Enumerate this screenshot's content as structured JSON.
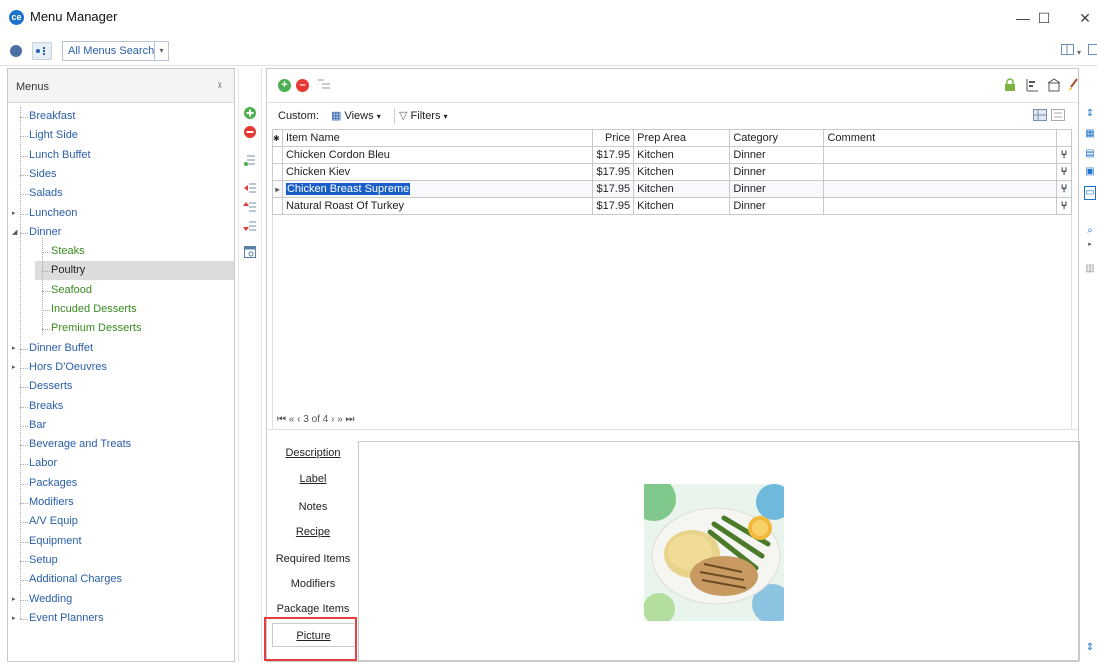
{
  "window": {
    "title": "Menu Manager",
    "minimize": "—",
    "maximize": "☐",
    "close": "✕"
  },
  "toolbar": {
    "search_label": "All Menus Search",
    "search_dropdown": "▾"
  },
  "left_panel": {
    "header": "Menus",
    "items": [
      {
        "label": "Breakfast",
        "level": 0,
        "expandable": false,
        "color": "#2a5ea8"
      },
      {
        "label": "Light Side",
        "level": 0,
        "expandable": false,
        "color": "#2a5ea8"
      },
      {
        "label": "Lunch Buffet",
        "level": 0,
        "expandable": false,
        "color": "#2a5ea8"
      },
      {
        "label": "Sides",
        "level": 0,
        "expandable": false,
        "color": "#2a5ea8"
      },
      {
        "label": "Salads",
        "level": 0,
        "expandable": false,
        "color": "#2a5ea8"
      },
      {
        "label": "Luncheon",
        "level": 0,
        "expandable": true,
        "color": "#2a5ea8"
      },
      {
        "label": "Dinner",
        "level": 0,
        "expanded": true,
        "color": "#2a5ea8"
      },
      {
        "label": "Steaks",
        "level": 1,
        "color": "#3a8a20"
      },
      {
        "label": "Poultry",
        "level": 1,
        "selected": true,
        "color": "#222222"
      },
      {
        "label": "Seafood",
        "level": 1,
        "color": "#3a8a20"
      },
      {
        "label": "Incuded Desserts",
        "level": 1,
        "color": "#3a8a20"
      },
      {
        "label": "Premium Desserts",
        "level": 1,
        "color": "#3a8a20"
      },
      {
        "label": "Dinner Buffet",
        "level": 0,
        "expandable": true,
        "color": "#2a5ea8"
      },
      {
        "label": "Hors D'Oeuvres",
        "level": 0,
        "expandable": true,
        "color": "#2a5ea8"
      },
      {
        "label": "Desserts",
        "level": 0,
        "color": "#2a5ea8"
      },
      {
        "label": "Breaks",
        "level": 0,
        "color": "#2a5ea8"
      },
      {
        "label": "Bar",
        "level": 0,
        "color": "#2a5ea8"
      },
      {
        "label": "Beverage and Treats",
        "level": 0,
        "color": "#2a5ea8"
      },
      {
        "label": "Labor",
        "level": 0,
        "color": "#2a5ea8"
      },
      {
        "label": "Packages",
        "level": 0,
        "color": "#2a5ea8"
      },
      {
        "label": "Modifiers",
        "level": 0,
        "color": "#2a5ea8"
      },
      {
        "label": "A/V Equip",
        "level": 0,
        "color": "#2a5ea8"
      },
      {
        "label": "Equipment",
        "level": 0,
        "color": "#2a5ea8"
      },
      {
        "label": "Setup",
        "level": 0,
        "color": "#2a5ea8"
      },
      {
        "label": "Additional Charges",
        "level": 0,
        "color": "#2a5ea8"
      },
      {
        "label": "Wedding",
        "level": 0,
        "expandable": true,
        "color": "#2a5ea8"
      },
      {
        "label": "Event Planners",
        "level": 0,
        "expandable": true,
        "color": "#2a5ea8"
      }
    ]
  },
  "grid": {
    "custom_label": "Custom:",
    "views_label": "Views",
    "filters_label": "Filters",
    "columns": [
      "Item Name",
      "Price",
      "Prep Area",
      "Category",
      "Comment"
    ],
    "rows": [
      {
        "name": "Chicken Cordon Bleu",
        "price": "$17.95",
        "prep": "Kitchen",
        "category": "Dinner",
        "comment": ""
      },
      {
        "name": "Chicken Kiev",
        "price": "$17.95",
        "prep": "Kitchen",
        "category": "Dinner",
        "comment": ""
      },
      {
        "name": "Chicken Breast Supreme",
        "price": "$17.95",
        "prep": "Kitchen",
        "category": "Dinner",
        "comment": "",
        "selected": true
      },
      {
        "name": "Natural Roast Of Turkey",
        "price": "$17.95",
        "prep": "Kitchen",
        "category": "Dinner",
        "comment": ""
      }
    ],
    "pager": "3 of 4"
  },
  "detail_tabs": [
    {
      "label": "Description",
      "underline": true
    },
    {
      "label": "Label",
      "underline": true
    },
    {
      "label": "Notes",
      "underline": false
    },
    {
      "label": "Recipe",
      "underline": true
    },
    {
      "label": "Required Items",
      "underline": false
    },
    {
      "label": "Modifiers",
      "underline": false
    },
    {
      "label": "Package Items",
      "underline": false
    },
    {
      "label": "Picture",
      "underline": true,
      "active": true
    }
  ],
  "colors": {
    "accent": "#1a73c9",
    "selection": "#1a5fc9",
    "highlight_box": "#e04040",
    "tree_link": "#2a5ea8",
    "tree_sub": "#3a8a20"
  }
}
